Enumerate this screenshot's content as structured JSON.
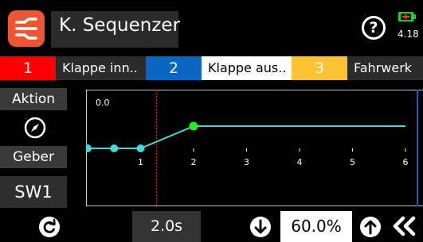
{
  "header": {
    "title": "K. Sequenzer",
    "help_label": "?",
    "battery_value": "4.18"
  },
  "tabs": [
    {
      "number": "1",
      "label": "Klappe inn..",
      "color": "#ff0000",
      "active": false
    },
    {
      "number": "2",
      "label": "Klappe aus..",
      "color": "#0a66c2",
      "active": true
    },
    {
      "number": "3",
      "label": "Fahrwerk",
      "color": "#ffc233",
      "active": false
    }
  ],
  "side": {
    "action_label": "Aktion",
    "action_icon": "compass-icon",
    "source_label": "Geber",
    "source_value": "SW1"
  },
  "footer": {
    "time_value": "2.0s",
    "value": "60.0%"
  },
  "chart_data": {
    "type": "line",
    "top_label": "0.0",
    "x_ticks": [
      "1",
      "2",
      "3",
      "4",
      "5",
      "6"
    ],
    "series": [
      {
        "x": [
          0.0,
          0.5,
          1.0,
          2.0,
          6.0
        ],
        "y": [
          0,
          0,
          0,
          1,
          1
        ]
      }
    ],
    "highlight_point": [
      2.0,
      1
    ],
    "cursor_x": 1.3,
    "colors": {
      "line": "#44d8d8",
      "highlight": "#22ee22",
      "cursor": "#dd2222",
      "frame": "#ffffff"
    }
  },
  "colors": {
    "accent": "#ee5533",
    "background": "#000000"
  }
}
